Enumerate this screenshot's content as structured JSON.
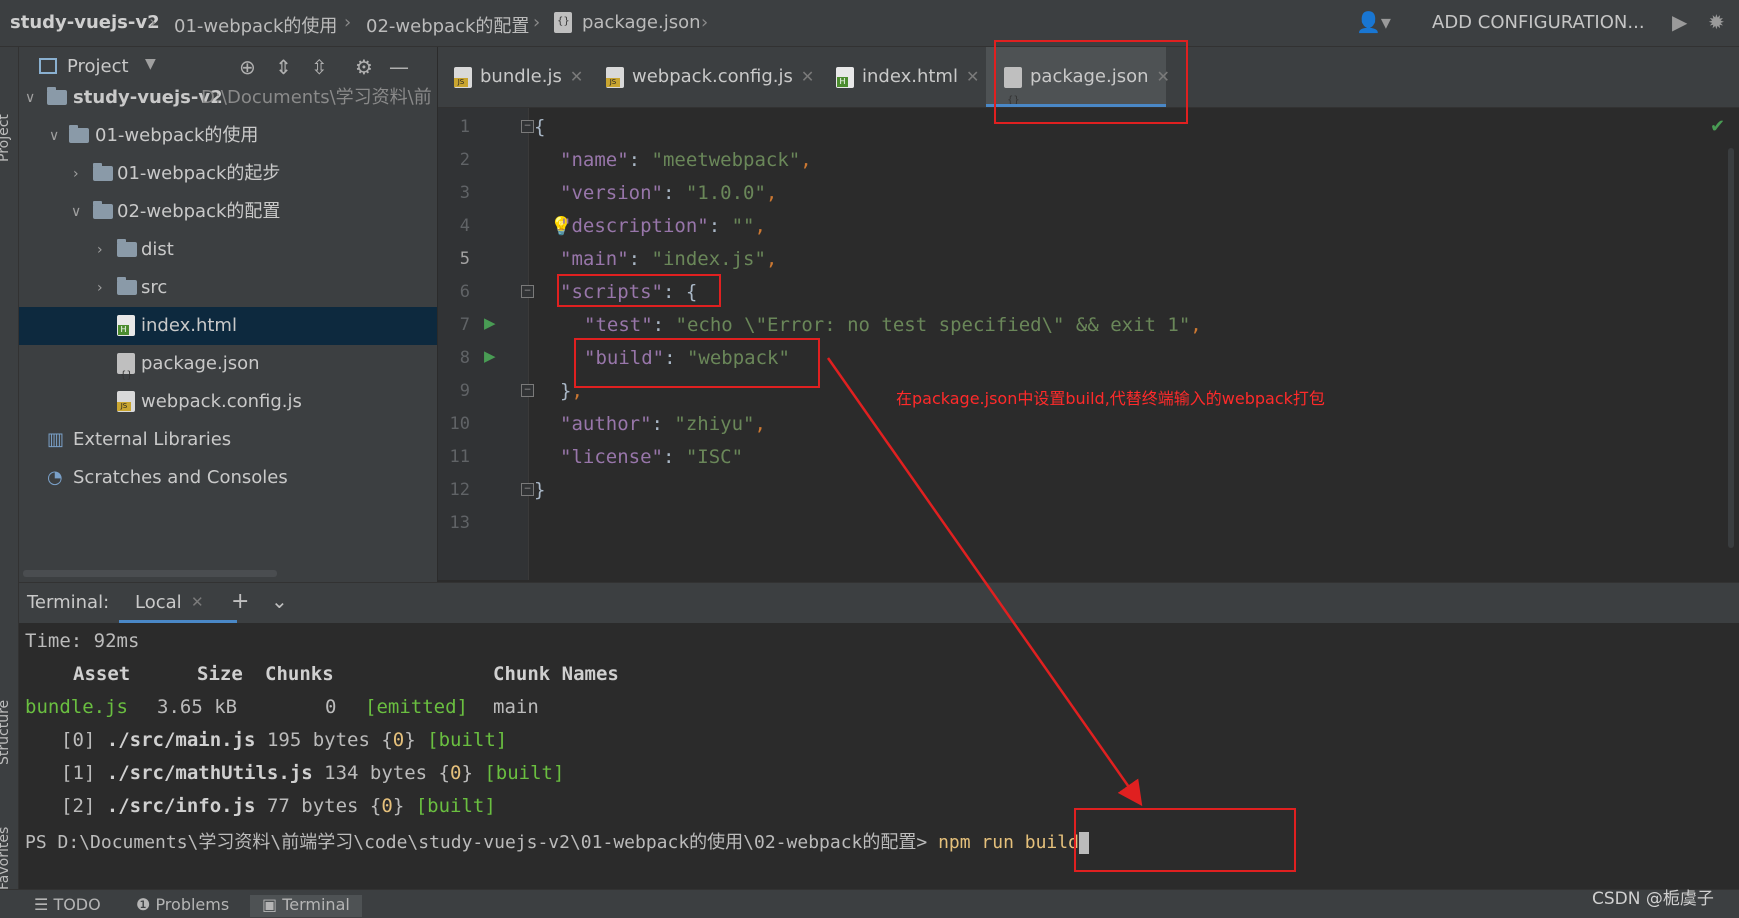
{
  "breadcrumb": [
    "study-vuejs-v2",
    "01-webpack的使用",
    "02-webpack的配置",
    "package.json"
  ],
  "toolbar": {
    "add_configuration": "ADD CONFIGURATION..."
  },
  "side_labels": {
    "project": "Project",
    "structure": "Structure",
    "favorites": "Favorites"
  },
  "project_panel": {
    "title": "Project",
    "tree": [
      {
        "label": "study-vuejs-v2",
        "path": "D:\\Documents\\学习资料\\前"
      },
      {
        "label": "01-webpack的使用"
      },
      {
        "label": "01-webpack的起步"
      },
      {
        "label": "02-webpack的配置"
      },
      {
        "label": "dist"
      },
      {
        "label": "src"
      },
      {
        "label": "index.html"
      },
      {
        "label": "package.json"
      },
      {
        "label": "webpack.config.js"
      },
      {
        "label": "External Libraries"
      },
      {
        "label": "Scratches and Consoles"
      }
    ]
  },
  "tabs": [
    {
      "label": "bundle.js"
    },
    {
      "label": "webpack.config.js"
    },
    {
      "label": "index.html"
    },
    {
      "label": "package.json",
      "active": true
    }
  ],
  "editor": {
    "line_numbers": [
      "1",
      "2",
      "3",
      "4",
      "5",
      "6",
      "7",
      "8",
      "9",
      "10",
      "11",
      "12",
      "13"
    ],
    "name_key": "\"name\"",
    "name_val": "\"meetwebpack\"",
    "version_key": "\"version\"",
    "version_val": "\"1.0.0\"",
    "description_key": "\"description\"",
    "description_val": "\"\"",
    "main_key": "\"main\"",
    "main_val": "\"index.js\"",
    "scripts_key": "\"scripts\"",
    "test_key": "\"test\"",
    "test_val": "\"echo \\\"Error: no test specified\\\" && exit 1\"",
    "build_key": "\"build\"",
    "build_val": "\"webpack\"",
    "author_key": "\"author\"",
    "author_val": "\"zhiyu\"",
    "license_key": "\"license\"",
    "license_val": "\"ISC\""
  },
  "annotation": "在package.json中设置build,代替终端输入的webpack打包",
  "terminal": {
    "label": "Terminal:",
    "tab": "Local",
    "time": "Time: 92ms",
    "headers": {
      "asset": "Asset",
      "size": "Size",
      "chunks": "Chunks",
      "chunk_names": "Chunk Names"
    },
    "bundle": {
      "name": "bundle.js",
      "size": "3.65 kB",
      "chunks": "0",
      "emitted": "[emitted]",
      "names": "main"
    },
    "modules": [
      {
        "id": "[0]",
        "path": "./src/main.js",
        "size": "195 bytes",
        "chunk": "0",
        "status": "[built]"
      },
      {
        "id": "[1]",
        "path": "./src/mathUtils.js",
        "size": "134 bytes",
        "chunk": "0",
        "status": "[built]"
      },
      {
        "id": "[2]",
        "path": "./src/info.js",
        "size": "77 bytes",
        "chunk": "0",
        "status": "[built]"
      }
    ],
    "prompt": "PS D:\\Documents\\学习资料\\前端学习\\code\\study-vuejs-v2\\01-webpack的使用\\02-webpack的配置>",
    "command": "npm run build"
  },
  "statusbar": {
    "todo": "TODO",
    "problems": "Problems",
    "terminal": "Terminal"
  },
  "watermark": "CSDN @栀虞子",
  "colors": {
    "annotation": "#e02020",
    "keyword": "#9876aa",
    "string": "#6a8759",
    "selection": "#0d293e"
  }
}
